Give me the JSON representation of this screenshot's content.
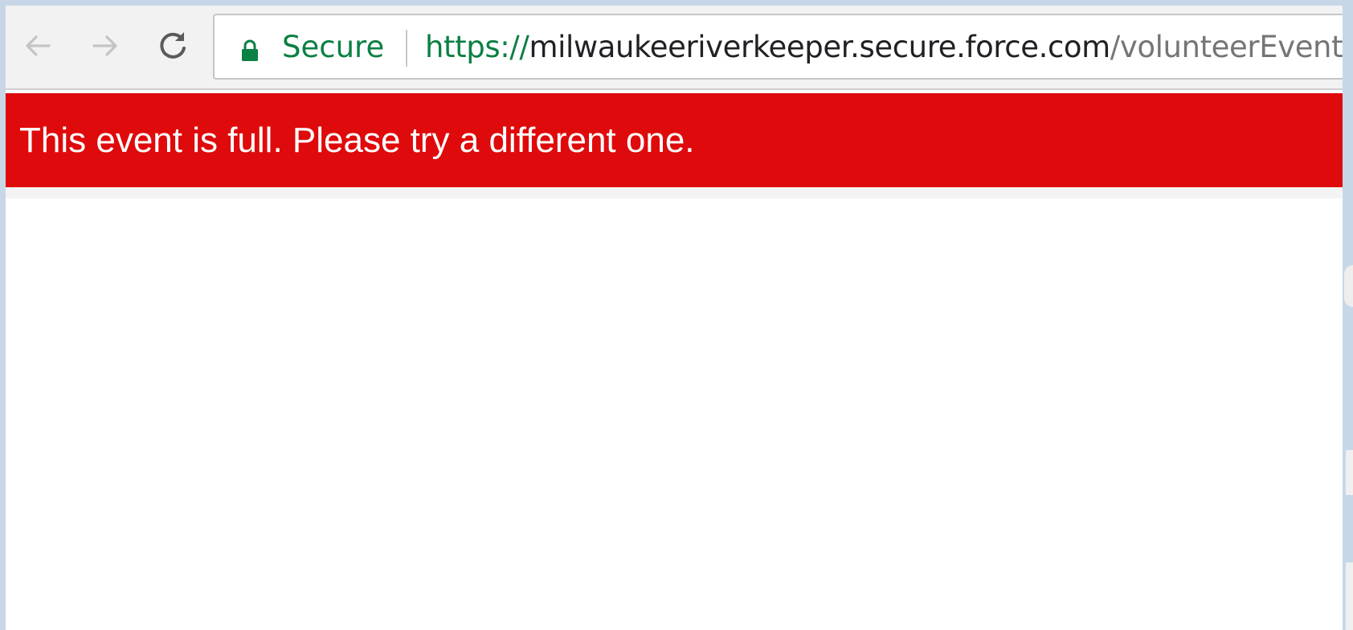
{
  "browser": {
    "back_icon": "arrow-left-icon",
    "forward_icon": "arrow-right-icon",
    "reload_icon": "reload-icon",
    "security_icon": "lock-icon",
    "security_label": "Secure",
    "url": {
      "scheme": "https://",
      "host": "milwaukeeriverkeeper.secure.force.com",
      "path": "/volunteerEvent"
    }
  },
  "banner": {
    "message": "This event is full. Please try a different one.",
    "background_color": "#df0a0b",
    "text_color": "#ffffff"
  },
  "colors": {
    "secure_green": "#0b8043",
    "frame": "#c7d7e8"
  }
}
